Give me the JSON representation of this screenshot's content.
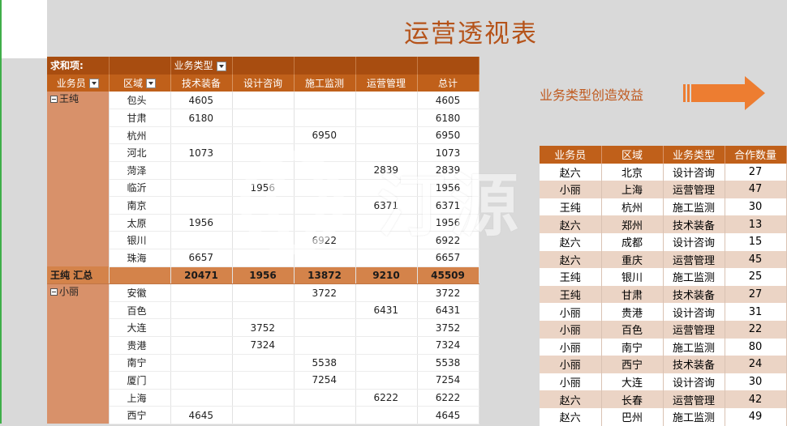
{
  "title": "运营透视表",
  "subtitle": "业务类型创造效益",
  "watermark": "汀源",
  "pivot": {
    "header1": [
      "求和项:",
      "",
      "业务类型"
    ],
    "header2": [
      "业务员",
      "区域",
      "技术装备",
      "设计咨询",
      "施工监测",
      "运营管理",
      "总计"
    ],
    "groups": [
      {
        "person": "王纯",
        "rows": [
          {
            "region": "包头",
            "v": [
              "4605",
              "",
              "",
              "",
              "4605"
            ]
          },
          {
            "region": "甘肃",
            "v": [
              "6180",
              "",
              "",
              "",
              "6180"
            ]
          },
          {
            "region": "杭州",
            "v": [
              "",
              "",
              "6950",
              "",
              "6950"
            ]
          },
          {
            "region": "河北",
            "v": [
              "1073",
              "",
              "",
              "",
              "1073"
            ]
          },
          {
            "region": "菏泽",
            "v": [
              "",
              "",
              "",
              "2839",
              "2839"
            ]
          },
          {
            "region": "临沂",
            "v": [
              "",
              "1956",
              "",
              "",
              "1956"
            ]
          },
          {
            "region": "南京",
            "v": [
              "",
              "",
              "",
              "6371",
              "6371"
            ]
          },
          {
            "region": "太原",
            "v": [
              "1956",
              "",
              "",
              "",
              "1956"
            ]
          },
          {
            "region": "银川",
            "v": [
              "",
              "",
              "6922",
              "",
              "6922"
            ]
          },
          {
            "region": "珠海",
            "v": [
              "6657",
              "",
              "",
              "",
              "6657"
            ]
          }
        ],
        "subtotal_label": "王纯 汇总",
        "subtotal": [
          "20471",
          "1956",
          "13872",
          "9210",
          "45509"
        ]
      },
      {
        "person": "小丽",
        "rows": [
          {
            "region": "安徽",
            "v": [
              "",
              "",
              "3722",
              "",
              "3722"
            ]
          },
          {
            "region": "百色",
            "v": [
              "",
              "",
              "",
              "6431",
              "6431"
            ]
          },
          {
            "region": "大连",
            "v": [
              "",
              "3752",
              "",
              "",
              "3752"
            ]
          },
          {
            "region": "贵港",
            "v": [
              "",
              "7324",
              "",
              "",
              "7324"
            ]
          },
          {
            "region": "南宁",
            "v": [
              "",
              "",
              "5538",
              "",
              "5538"
            ]
          },
          {
            "region": "厦门",
            "v": [
              "",
              "",
              "7254",
              "",
              "7254"
            ]
          },
          {
            "region": "上海",
            "v": [
              "",
              "",
              "",
              "6222",
              "6222"
            ]
          },
          {
            "region": "西宁",
            "v": [
              "4645",
              "",
              "",
              "",
              "4645"
            ]
          }
        ]
      }
    ]
  },
  "source_table": {
    "headers": [
      "业务员",
      "区域",
      "业务类型",
      "合作数量"
    ],
    "rows": [
      [
        "赵六",
        "北京",
        "设计咨询",
        "27"
      ],
      [
        "小丽",
        "上海",
        "运营管理",
        "47"
      ],
      [
        "王纯",
        "杭州",
        "施工监测",
        "30"
      ],
      [
        "赵六",
        "郑州",
        "技术装备",
        "13"
      ],
      [
        "赵六",
        "成都",
        "设计咨询",
        "15"
      ],
      [
        "赵六",
        "重庆",
        "运营管理",
        "45"
      ],
      [
        "王纯",
        "银川",
        "施工监测",
        "25"
      ],
      [
        "王纯",
        "甘肃",
        "技术装备",
        "27"
      ],
      [
        "小丽",
        "贵港",
        "设计咨询",
        "31"
      ],
      [
        "小丽",
        "百色",
        "运营管理",
        "22"
      ],
      [
        "小丽",
        "南宁",
        "施工监测",
        "80"
      ],
      [
        "小丽",
        "西宁",
        "技术装备",
        "24"
      ],
      [
        "小丽",
        "大连",
        "设计咨询",
        "30"
      ],
      [
        "赵六",
        "长春",
        "运营管理",
        "42"
      ],
      [
        "赵六",
        "巴州",
        "施工监测",
        "49"
      ]
    ]
  },
  "colors": {
    "header": "#c0601a",
    "header_dark": "#a84d10",
    "person_cell": "#d8916a",
    "subtotal": "#d4834a",
    "title": "#b5531a",
    "arrow": "#ed7d31"
  },
  "icons": [
    "filter-dropdown-icon",
    "collapse-minus-icon",
    "right-arrow-icon"
  ]
}
